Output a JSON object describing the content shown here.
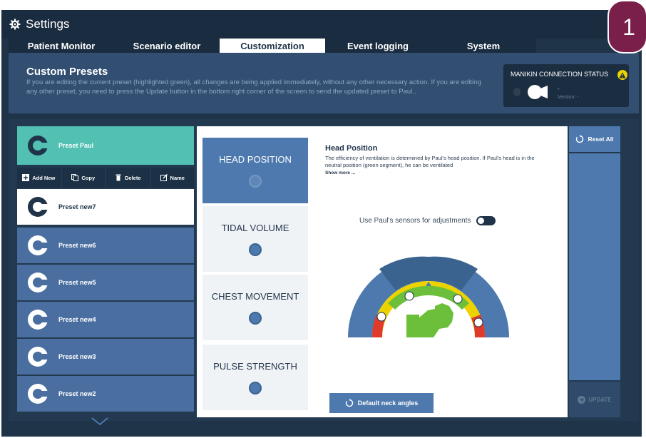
{
  "window": {
    "title": "Settings"
  },
  "tabs": [
    {
      "label": "Patient Monitor"
    },
    {
      "label": "Scenario editor"
    },
    {
      "label": "Customization",
      "active": true
    },
    {
      "label": "Event logging"
    },
    {
      "label": "System"
    }
  ],
  "banner": {
    "title": "Custom Presets",
    "text": "If you are editing the current preset (highlighted green), all changes are being applied immediately, without any other necessary action. If you are editing any other preset, you need to press the Update button in the bottom right corner of the screen to send the updated preset to Paul.."
  },
  "connection": {
    "title": "MANIKIN CONNECTION STATUS",
    "dash": "-",
    "version": "Version: -",
    "warning_color": "#ecd300"
  },
  "presets": {
    "current": "Preset Paul",
    "actions": {
      "add": "Add New",
      "copy": "Copy",
      "delete": "Delete",
      "name": "Name"
    },
    "items": [
      "Preset new7",
      "Preset new6",
      "Preset new5",
      "Preset new4",
      "Preset new3",
      "Preset new2"
    ]
  },
  "parameters": [
    {
      "label": "HEAD POSITION",
      "active": true
    },
    {
      "label": "TIDAL VOLUME"
    },
    {
      "label": "CHEST MOVEMENT"
    },
    {
      "label": "PULSE STRENGTH"
    }
  ],
  "detail": {
    "title": "Head Position",
    "text": "The efficiency of ventilation is determined by Paul's head position. If Paul's head is in the neutral position (green segment), he can be ventilated",
    "show_more": "Show more ...",
    "sensor_label": "Use Paul's sensors for adjustments",
    "sensor_on": true,
    "default_button": "Default neck angles",
    "gauge_colors": {
      "green": "#6cbf3a",
      "yellow": "#ecd300",
      "red": "#e03a2a",
      "arc": "#4e79ae",
      "dark": "#3b638f"
    }
  },
  "right": {
    "reset": "Reset All",
    "update": "UPDATE"
  },
  "badge": {
    "number": "1",
    "color": "#7a1f4a"
  }
}
